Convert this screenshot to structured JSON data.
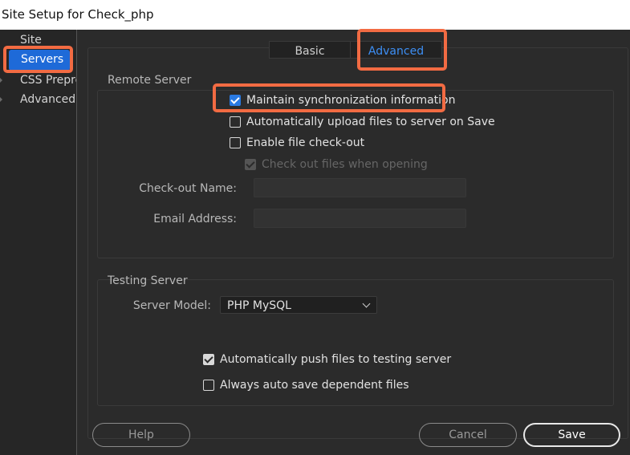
{
  "window": {
    "title": "Site Setup for Check_php"
  },
  "sidebar": {
    "items": [
      {
        "label": "Site"
      },
      {
        "label": "Servers"
      },
      {
        "label": "CSS Preprocessors"
      },
      {
        "label": "Advanced Settings"
      }
    ]
  },
  "tabs": [
    {
      "label": "Basic"
    },
    {
      "label": "Advanced"
    }
  ],
  "remote_server": {
    "heading": "Remote Server",
    "maintain_sync": {
      "label": "Maintain synchronization information",
      "checked": true
    },
    "auto_upload": {
      "label": "Automatically upload files to server on Save",
      "checked": false
    },
    "file_checkout": {
      "label": "Enable file check-out",
      "checked": false
    },
    "checkout_opening": {
      "label": "Check out files when opening",
      "checked": true,
      "disabled": true
    },
    "checkout_name_label": "Check-out Name:",
    "checkout_name_value": "",
    "email_label": "Email Address:",
    "email_value": ""
  },
  "testing_server": {
    "heading": "Testing Server",
    "server_model_label": "Server Model:",
    "server_model_value": "PHP MySQL",
    "auto_push": {
      "label": "Automatically push files to testing server",
      "checked": true
    },
    "auto_save_dependent": {
      "label": "Always auto save dependent files",
      "checked": false
    }
  },
  "buttons": {
    "help": "Help",
    "cancel": "Cancel",
    "save": "Save"
  },
  "colors": {
    "accent": "#1e6ad8",
    "highlight": "#f26b43",
    "active_tab_text": "#3d8ff5"
  }
}
